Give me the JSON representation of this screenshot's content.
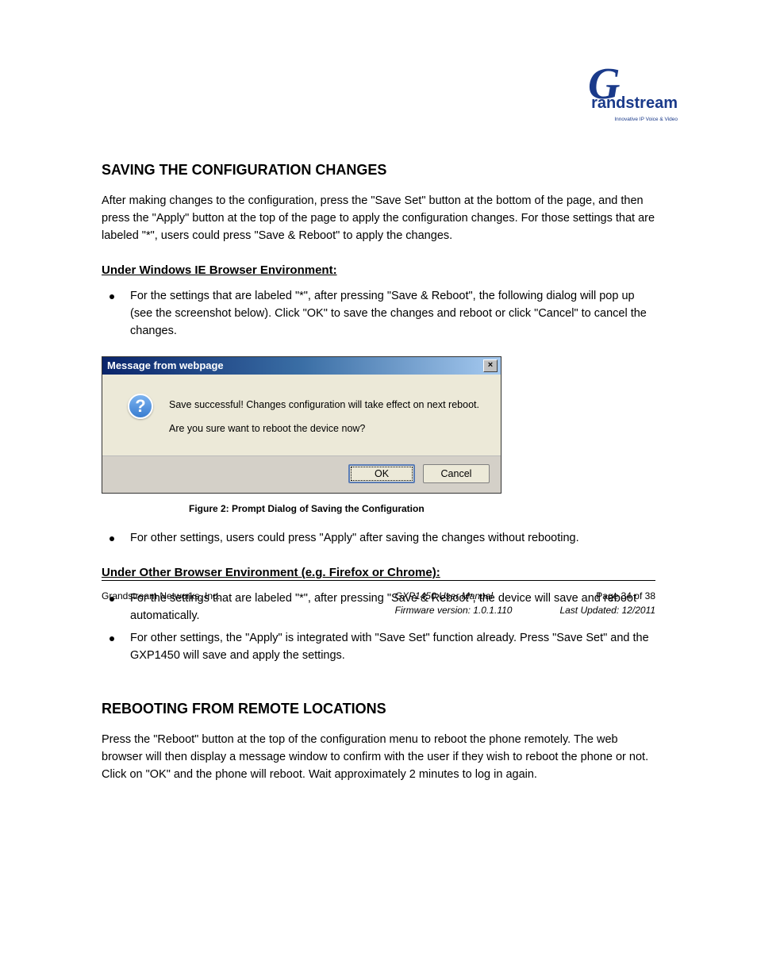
{
  "logo": {
    "brand_text": "randstream",
    "brand_g": "G",
    "tagline": "Innovative IP Voice & Video"
  },
  "sections": {
    "title": "SAVING THE CONFIGURATION CHANGES",
    "intro": "After making changes to the configuration, press the \"Save Set\" button at the bottom of the page, and then press the \"Apply\" button at the top of the page to apply the configuration changes. For those settings that are labeled \"*\", users could press \"Save & Reboot\" to apply the changes.",
    "windows_title": "Under Windows IE Browser Environment:",
    "windows_bullet": "For the settings that are labeled \"*\", after pressing \"Save & Reboot\", the following dialog will pop up (see the screenshot below). Click \"OK\" to save the changes and reboot or click \"Cancel\" to cancel the changes.",
    "windows_bullet2": "For other settings, users could press \"Apply\" after saving the changes without rebooting.",
    "other_title": "Under Other Browser Environment (e.g. Firefox or Chrome):",
    "other_bullet1": "For the settings that are labeled \"*\", after pressing \"Save & Reboot\", the device will save and reboot automatically.",
    "other_bullet2": "For other settings, the \"Apply\" is integrated with \"Save Set\" function already. Press \"Save Set\" and the GXP1450 will save and apply the settings.",
    "dialog": {
      "title": "Message from webpage",
      "message_line1": "Save successful! Changes configuration will take effect on next reboot.",
      "message_line2": "Are you sure want to reboot the device now?",
      "ok_label": "OK",
      "cancel_label": "Cancel",
      "icon_glyph": "?"
    },
    "figure_caption": "Figure 2: Prompt Dialog of Saving the Configuration",
    "reboot_title": "REBOOTING FROM REMOTE LOCATIONS",
    "reboot_text": "Press the \"Reboot\" button at the top of the configuration menu to reboot the phone remotely. The web browser will then display a message window to confirm with the user if they wish to reboot the phone or not. Click on \"OK\" and the phone will reboot. Wait approximately 2 minutes to log in again."
  },
  "footer": {
    "left_line1": "Grandstream Networks, Inc.",
    "right_line1": "GXP1450 User Manual",
    "right_line2": "Firmware version: 1.0.1.110",
    "right_page": "Page 34 of 38",
    "right_date": "Last Updated:  12/2011"
  }
}
